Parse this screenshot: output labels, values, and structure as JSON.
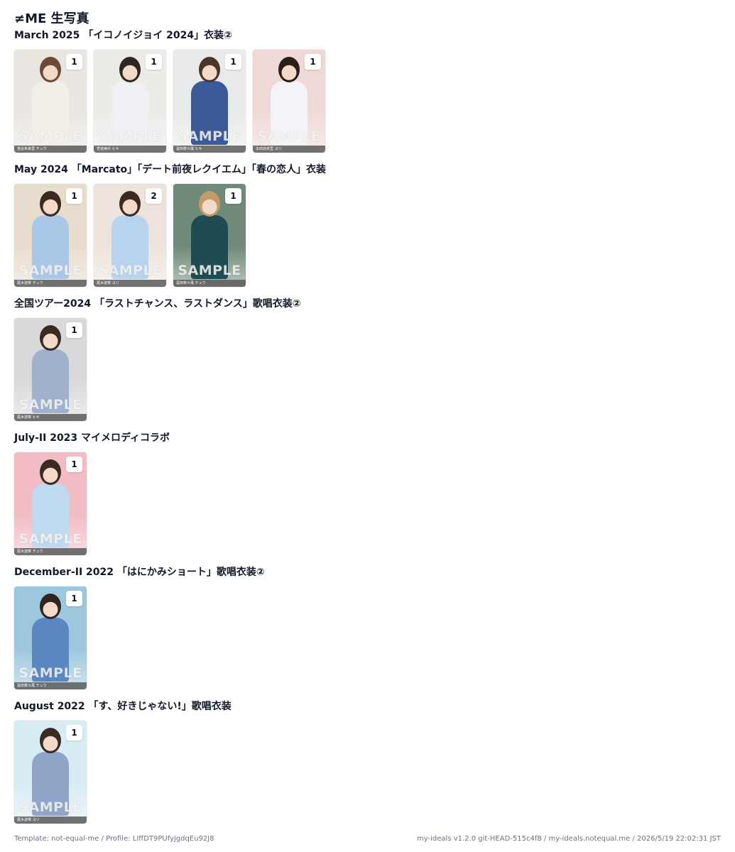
{
  "page": {
    "title": "≠ME 生写真"
  },
  "sections": [
    {
      "title": "March 2025 「イコノイジョイ 2024」衣装②",
      "cards": [
        {
          "count": "1",
          "sample": "SAMPLE",
          "name": "落合希来里 チュウ",
          "bg": "#e9e6e2",
          "head": "#6b4a3a",
          "outfit": "#f3efe6"
        },
        {
          "count": "1",
          "sample": "SAMPLE",
          "name": "菅波美玲 ヒキ",
          "bg": "#ecebe8",
          "head": "#2e2622",
          "outfit": "#eef0f4"
        },
        {
          "count": "1",
          "sample": "SAMPLE",
          "name": "冨田菜々風 ヒキ",
          "bg": "#e9eaeb",
          "head": "#4a3529",
          "outfit": "#3d5a98"
        },
        {
          "count": "1",
          "sample": "SAMPLE",
          "name": "永田詩央里 ヨリ",
          "bg": "#eed9d6",
          "head": "#2b1d18",
          "outfit": "#f4f4f8"
        }
      ]
    },
    {
      "title": "May 2024 「Marcato」「デート前夜レクイエム」「春の恋人」衣装",
      "cards": [
        {
          "count": "1",
          "sample": "SAMPLE",
          "name": "尾木波菜 チュウ",
          "bg": "#e8dccc",
          "head": "#3a2a22",
          "outfit": "#a9c8e8"
        },
        {
          "count": "2",
          "sample": "SAMPLE",
          "name": "尾木波菜 ヨリ",
          "bg": "#eee3dc",
          "head": "#3a2a22",
          "outfit": "#b8d3ee"
        },
        {
          "count": "1",
          "sample": "SAMPLE",
          "name": "冨田菜々風 チュウ",
          "bg": "#6f8a78",
          "head": "#c49a6c",
          "outfit": "#1f4b52"
        }
      ]
    },
    {
      "title": "全国ツアー2024 「ラストチャンス、ラストダンス」歌唱衣装②",
      "cards": [
        {
          "count": "1",
          "sample": "SAMPLE",
          "name": "尾木波菜 ヒキ",
          "bg": "#d9d9dc",
          "head": "#3a2a22",
          "outfit": "#9fb2cc"
        }
      ]
    },
    {
      "title": "July-II 2023 マイメロディコラボ",
      "cards": [
        {
          "count": "1",
          "sample": "SAMPLE",
          "name": "尾木波菜 チュウ",
          "bg": "#f1bcc4",
          "head": "#3a2a22",
          "outfit": "#bfd9ee"
        }
      ]
    },
    {
      "title": "December-II 2022 「はにかみショート」歌唱衣装②",
      "cards": [
        {
          "count": "1",
          "sample": "SAMPLE",
          "name": "冨田菜々風 チュウ",
          "bg": "#9cc7dd",
          "head": "#2e2420",
          "outfit": "#5a86c2"
        }
      ]
    },
    {
      "title": "August 2022 「す、好きじゃない!」歌唱衣装",
      "cards": [
        {
          "count": "1",
          "sample": "SAMPLE",
          "name": "尾木波菜 ヨリ",
          "bg": "#d8ecf4",
          "head": "#3a2a22",
          "outfit": "#8fa6c8"
        }
      ]
    }
  ],
  "footer": {
    "left": "Template: not-equal-me / Profile: LIffDT9PUfyjgdqEu92J8",
    "right": "my-ideals v1.2.0 git-HEAD-515c4f8 / my-ideals.notequal.me / 2026/5/19 22:02:31 JST"
  }
}
